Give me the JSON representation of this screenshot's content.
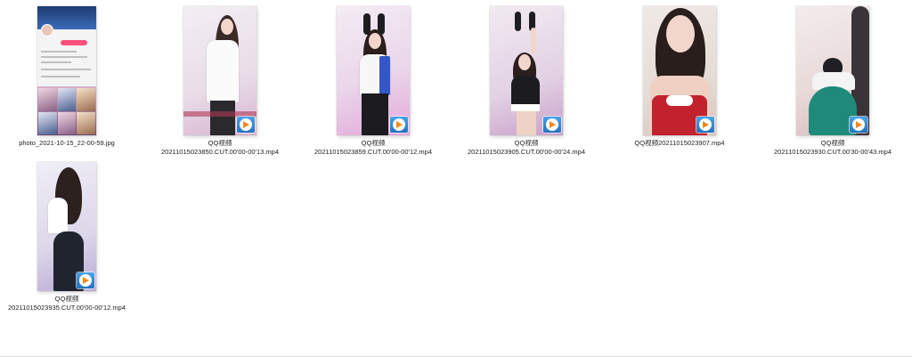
{
  "window": {
    "view": "large-icons"
  },
  "files": [
    {
      "type": "image",
      "icon": "image-thumbnail-icon",
      "name_lines": [
        "photo_2021-10-15_22-00-59.jpg"
      ]
    },
    {
      "type": "video",
      "icon": "play-badge-icon",
      "name_lines": [
        "QQ视频",
        "20211015023850.CUT.00'00-00'13.mp4"
      ]
    },
    {
      "type": "video",
      "icon": "play-badge-icon",
      "name_lines": [
        "QQ视频",
        "20211015023859.CUT.00'00-00'12.mp4"
      ]
    },
    {
      "type": "video",
      "icon": "play-badge-icon",
      "name_lines": [
        "QQ视频",
        "20211015023905.CUT.00'00-00'24.mp4"
      ]
    },
    {
      "type": "video",
      "icon": "play-badge-icon",
      "name_lines": [
        "QQ视频20211015023907.mp4"
      ]
    },
    {
      "type": "video",
      "icon": "play-badge-icon",
      "name_lines": [
        "QQ视频",
        "20211015023930.CUT.00'30-00'43.mp4"
      ]
    },
    {
      "type": "video",
      "icon": "play-badge-icon",
      "name_lines": [
        "QQ视频",
        "20211015023935.CUT.00'00-00'12.mp4"
      ]
    }
  ],
  "colors": {
    "background": "#ffffff",
    "badge_blue": "#2373c2",
    "play_orange": "#f08a1c"
  }
}
